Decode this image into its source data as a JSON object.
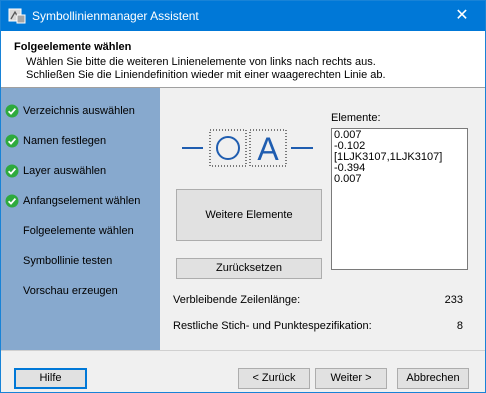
{
  "window": {
    "title": "Symbollinienmanager Assistent",
    "close_glyph": "✕",
    "app_icon": "symbol-line-manager-icon"
  },
  "header": {
    "title": "Folgeelemente wählen",
    "desc_line1": "Wählen Sie bitte die weiteren Linienelemente von links nach rechts aus.",
    "desc_line2": "Schließen Sie die Liniendefinition wieder mit einer waagerechten Linie ab."
  },
  "steps": [
    {
      "label": "Verzeichnis auswählen",
      "done": true
    },
    {
      "label": "Namen festlegen",
      "done": true
    },
    {
      "label": "Layer auswählen",
      "done": true
    },
    {
      "label": "Anfangselement wählen",
      "done": true
    },
    {
      "label": "Folgeelemente wählen",
      "done": false
    },
    {
      "label": "Symbollinie testen",
      "done": false
    },
    {
      "label": "Vorschau erzeugen",
      "done": false
    }
  ],
  "preview": {
    "letter": "A",
    "color": "#1f5db0"
  },
  "buttons": {
    "more_elements": "Weitere Elemente",
    "reset": "Zurücksetzen"
  },
  "elements": {
    "label": "Elemente:",
    "lines": [
      "0.007",
      "-0.102",
      "[1LJK3107,1LJK3107]",
      "-0.394",
      "0.007"
    ]
  },
  "info": {
    "remaining_length_label": "Verbleibende Zeilenlänge:",
    "remaining_length_value": "233",
    "rest_spec_label": "Restliche Stich- und Punktespezifikation:",
    "rest_spec_value": "8"
  },
  "footer": {
    "help": "Hilfe",
    "back": "< Zurück",
    "next": "Weiter >",
    "cancel": "Abbrechen"
  },
  "colors": {
    "titlebar": "#0078d7",
    "sidebar": "#87a9ce",
    "check": "#2eaa3e"
  }
}
